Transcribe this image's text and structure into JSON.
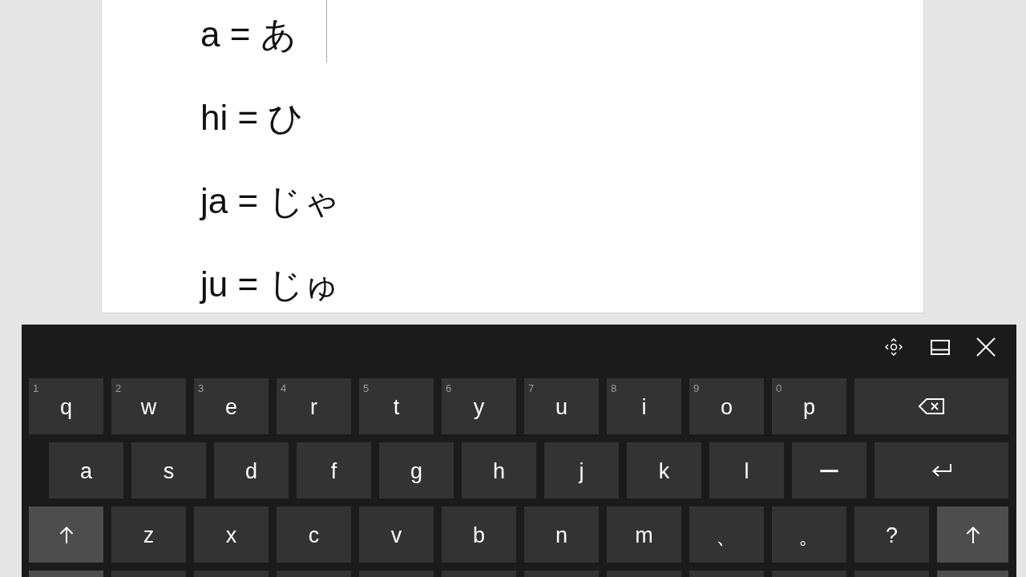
{
  "document": {
    "lines": [
      "a = あ",
      "hi = ひ",
      "ja = じゃ",
      "ju = じゅ"
    ]
  },
  "keyboard": {
    "rows": [
      [
        {
          "kind": "char",
          "label": "q",
          "hint": "1"
        },
        {
          "kind": "char",
          "label": "w",
          "hint": "2"
        },
        {
          "kind": "char",
          "label": "e",
          "hint": "3"
        },
        {
          "kind": "char",
          "label": "r",
          "hint": "4"
        },
        {
          "kind": "char",
          "label": "t",
          "hint": "5"
        },
        {
          "kind": "char",
          "label": "y",
          "hint": "6"
        },
        {
          "kind": "char",
          "label": "u",
          "hint": "7"
        },
        {
          "kind": "char",
          "label": "i",
          "hint": "8"
        },
        {
          "kind": "char",
          "label": "o",
          "hint": "9"
        },
        {
          "kind": "char",
          "label": "p",
          "hint": "0"
        },
        {
          "kind": "backspace"
        }
      ],
      [
        {
          "kind": "char",
          "label": "a"
        },
        {
          "kind": "char",
          "label": "s"
        },
        {
          "kind": "char",
          "label": "d"
        },
        {
          "kind": "char",
          "label": "f"
        },
        {
          "kind": "char",
          "label": "g"
        },
        {
          "kind": "char",
          "label": "h"
        },
        {
          "kind": "char",
          "label": "j"
        },
        {
          "kind": "char",
          "label": "k"
        },
        {
          "kind": "char",
          "label": "l"
        },
        {
          "kind": "char",
          "label": "ー"
        },
        {
          "kind": "enter"
        }
      ],
      [
        {
          "kind": "shift"
        },
        {
          "kind": "char",
          "label": "z"
        },
        {
          "kind": "char",
          "label": "x"
        },
        {
          "kind": "char",
          "label": "c"
        },
        {
          "kind": "char",
          "label": "v"
        },
        {
          "kind": "char",
          "label": "b"
        },
        {
          "kind": "char",
          "label": "n"
        },
        {
          "kind": "char",
          "label": "m"
        },
        {
          "kind": "char",
          "label": "、"
        },
        {
          "kind": "char",
          "label": "。"
        },
        {
          "kind": "char",
          "label": "?"
        },
        {
          "kind": "shift"
        }
      ],
      [
        {
          "kind": "function"
        },
        {
          "kind": "blank"
        },
        {
          "kind": "blank"
        },
        {
          "kind": "blank"
        },
        {
          "kind": "blank"
        },
        {
          "kind": "blank"
        },
        {
          "kind": "blank"
        },
        {
          "kind": "blank"
        },
        {
          "kind": "blank"
        },
        {
          "kind": "blank"
        },
        {
          "kind": "blank"
        },
        {
          "kind": "function"
        }
      ]
    ]
  }
}
